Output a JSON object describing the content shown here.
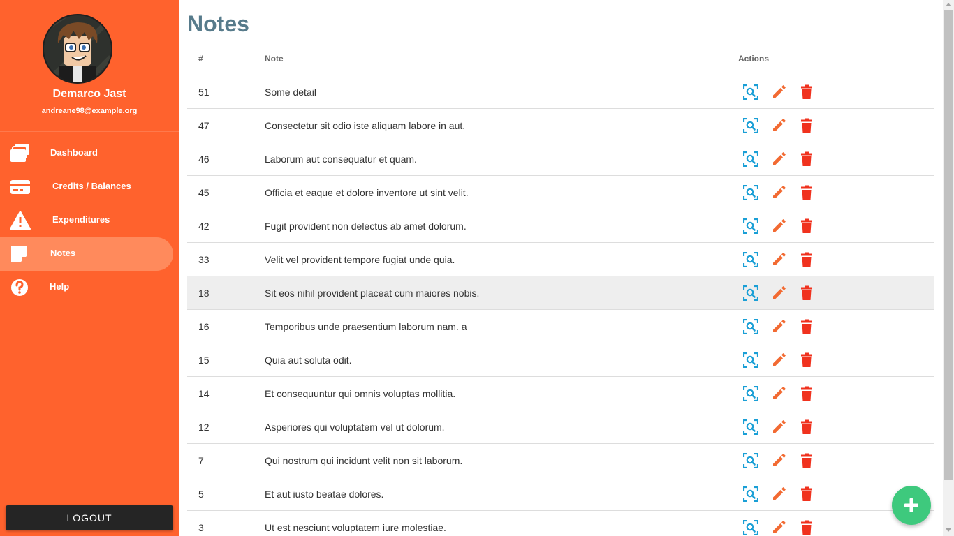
{
  "user": {
    "name": "Demarco Jast",
    "email": "andreane98@example.org"
  },
  "sidebar": {
    "items": [
      {
        "label": "Dashboard",
        "icon": "dashboard-icon",
        "active": false
      },
      {
        "label": "Credits / Balances",
        "icon": "credit-card-icon",
        "active": false
      },
      {
        "label": "Expenditures",
        "icon": "warning-icon",
        "active": false
      },
      {
        "label": "Notes",
        "icon": "note-icon",
        "active": true
      },
      {
        "label": "Help",
        "icon": "help-icon",
        "active": false
      }
    ],
    "logout_label": "LOGOUT"
  },
  "page": {
    "title": "Notes"
  },
  "table": {
    "headers": {
      "num": "#",
      "note": "Note",
      "actions": "Actions"
    },
    "rows": [
      {
        "num": "51",
        "note": "Some detail"
      },
      {
        "num": "47",
        "note": "Consectetur sit odio iste aliquam labore in aut."
      },
      {
        "num": "46",
        "note": "Laborum aut consequatur et quam."
      },
      {
        "num": "45",
        "note": "Officia et eaque et dolore inventore ut sint velit."
      },
      {
        "num": "42",
        "note": "Fugit provident non delectus ab amet dolorum."
      },
      {
        "num": "33",
        "note": "Velit vel provident tempore fugiat unde quia."
      },
      {
        "num": "18",
        "note": "Sit eos nihil provident placeat cum maiores nobis.",
        "highlight": true
      },
      {
        "num": "16",
        "note": "Temporibus unde praesentium laborum nam. a"
      },
      {
        "num": "15",
        "note": "Quia aut soluta odit."
      },
      {
        "num": "14",
        "note": "Et consequuntur qui omnis voluptas mollitia."
      },
      {
        "num": "12",
        "note": "Asperiores qui voluptatem vel ut dolorum."
      },
      {
        "num": "7",
        "note": "Qui nostrum qui incidunt velit non sit laborum."
      },
      {
        "num": "5",
        "note": "Et aut iusto beatae dolores."
      },
      {
        "num": "3",
        "note": "Ut est nesciunt voluptatem iure molestiae."
      }
    ]
  },
  "colors": {
    "sidebar_bg": "#ff622d",
    "active_item_bg": "#ff8a5c",
    "title": "#577b8b",
    "view_icon": "#1a9fd6",
    "edit_icon": "#f26a32",
    "delete_icon": "#f0321e",
    "fab": "#3ec97d"
  }
}
